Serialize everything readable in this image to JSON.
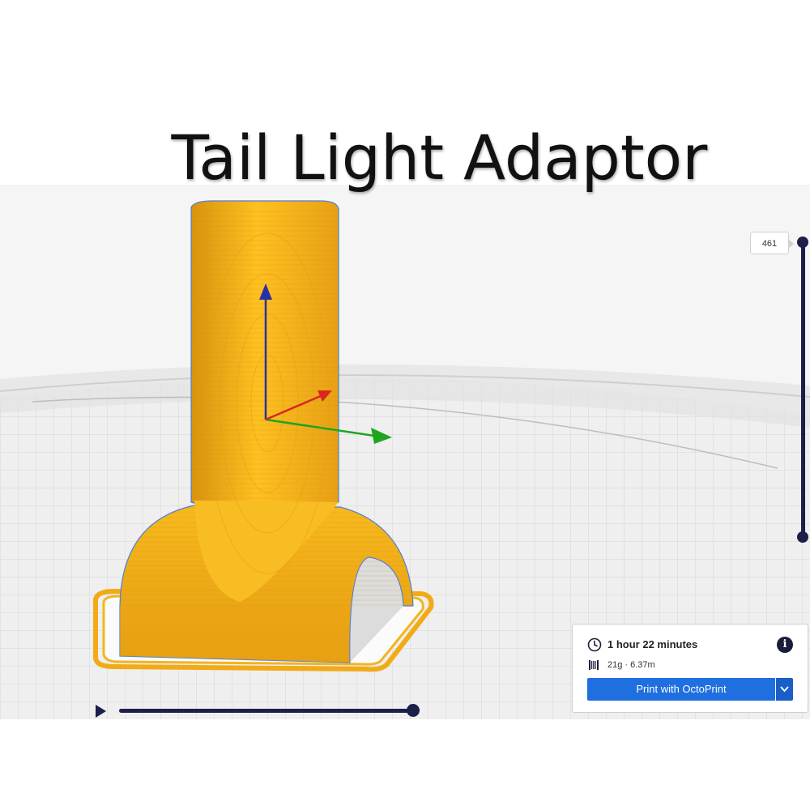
{
  "page": {
    "title": "Tail Light Adaptor"
  },
  "layer_view": {
    "current_layer": "461"
  },
  "print_info": {
    "duration": "1 hour 22 minutes",
    "material": "21g · 6.37m",
    "print_button_label": "Print with OctoPrint",
    "icons": [
      "clock-icon",
      "info-icon",
      "spool-icon",
      "chevron-down-icon"
    ]
  },
  "colors": {
    "model": "#f7b21c",
    "model_shadow": "#d8940e",
    "slider": "#1c1f4a",
    "accent_button": "#1f6fe0",
    "axis_x": "#d8281f",
    "axis_y": "#1ea51e",
    "axis_z": "#2b2fa6"
  }
}
